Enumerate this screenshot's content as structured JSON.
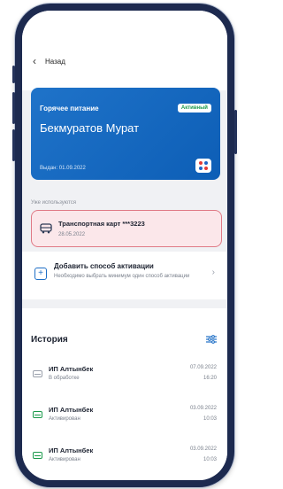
{
  "header": {
    "back_label": "Назад"
  },
  "card": {
    "title": "Горячее питание",
    "status_badge": "Активный",
    "holder_name": "Бекмуратов Мурат",
    "issued": "Выдан: 01.09.2022",
    "accent": "#1f73c9"
  },
  "active_section": {
    "label": "Уже используются",
    "items": [
      {
        "title": "Транспортная карт ***3223",
        "date": "28.05.2022"
      }
    ]
  },
  "add_method": {
    "title": "Добавить способ активации",
    "description": "Необходимо выбрать минимум один способ активации"
  },
  "history": {
    "title": "История",
    "rows": [
      {
        "name": "ИП Алтынбек",
        "status": "В обработке",
        "date": "07.09.2022",
        "time": "16:20",
        "icon_color": "#9aa0ab"
      },
      {
        "name": "ИП Алтынбек",
        "status": "Активирован",
        "date": "03.09.2022",
        "time": "10:03",
        "icon_color": "#1a9a4b"
      },
      {
        "name": "ИП Алтынбек",
        "status": "Активирован",
        "date": "03.09.2022",
        "time": "10:03",
        "icon_color": "#1a9a4b"
      }
    ]
  }
}
